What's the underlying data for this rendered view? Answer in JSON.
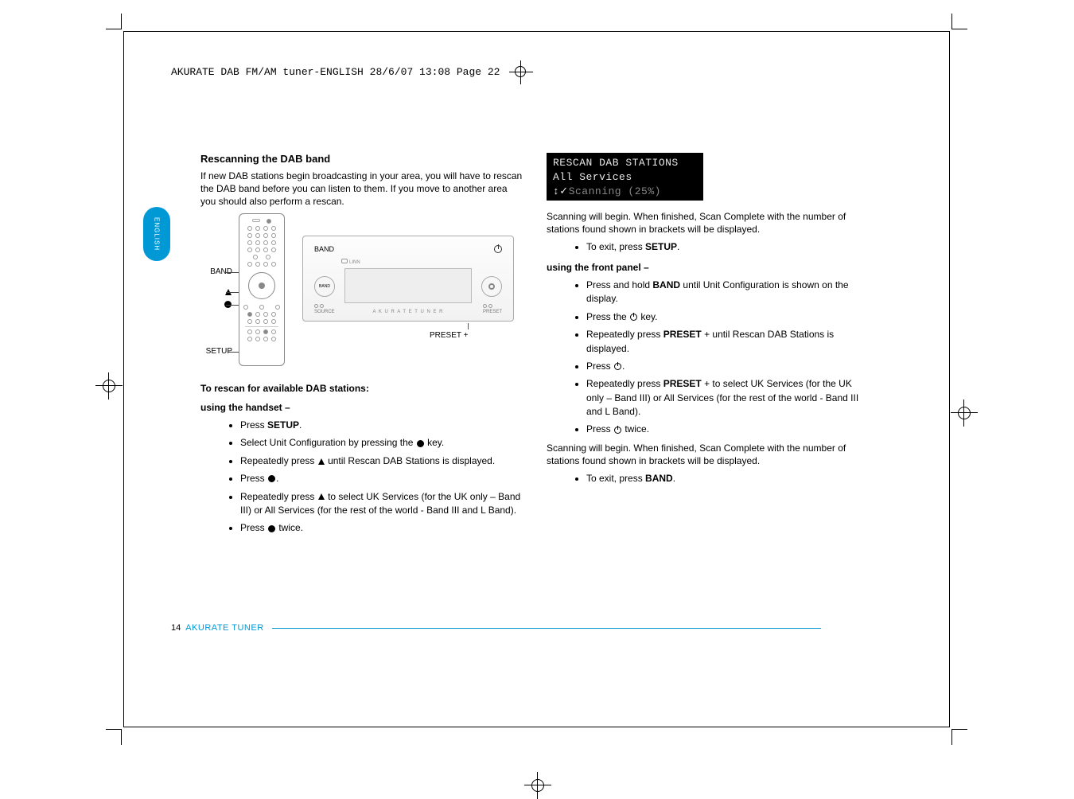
{
  "header": "AKURATE DAB FM/AM tuner-ENGLISH  28/6/07  13:08  Page 22",
  "lang_tab": "ENGLISH",
  "left": {
    "title": "Rescanning the DAB band",
    "intro": "If new DAB stations begin broadcasting in your area, you will have to rescan the DAB band before you can listen to them. If you move to another area you should also perform a rescan.",
    "diagram": {
      "remote_labels": {
        "band": "BAND",
        "up": "",
        "ok": "",
        "setup": "SETUP"
      },
      "device_labels": {
        "band": "BAND",
        "preset": "PRESET +",
        "brand": "A K U R A T E   T U N E R",
        "source": "SOURCE",
        "preset_small": "PRESET",
        "linn": "LINN",
        "band_btn": "BAND"
      }
    },
    "heading2": "To rescan for available DAB stations:",
    "sub1": "using the handset –",
    "steps": {
      "s1a": "Press ",
      "s1b": "SETUP",
      "s1c": ".",
      "s2a": "Select Unit Configuration by pressing the ",
      "s2b": " key.",
      "s3a": "Repeatedly press ",
      "s3b": " until Rescan DAB Stations is displayed.",
      "s4a": "Press ",
      "s4b": ".",
      "s5a": "Repeatedly press ",
      "s5b": " to select UK Services (for the UK only – Band III) or All Services (for the rest of the world - Band III and L Band).",
      "s6a": "Press ",
      "s6b": " twice."
    }
  },
  "right": {
    "lcd": {
      "l1": "RESCAN DAB STATIONS",
      "l2": " All Services",
      "l3a": "↕✓",
      "l3b": "Scanning (25%)"
    },
    "after_scan": "Scanning will begin. When finished, Scan Complete with the number of stations found shown in brackets will be displayed.",
    "exit_setup_a": "To exit, press ",
    "exit_setup_b": "SETUP",
    "exit_setup_c": ".",
    "sub2": "using the front panel –",
    "fp": {
      "s1a": "Press and hold ",
      "s1b": "BAND",
      "s1c": " until Unit Configuration is shown on the display.",
      "s2a": "Press the ",
      "s2b": " key.",
      "s3a": "Repeatedly press ",
      "s3b": "PRESET",
      "s3c": " + until Rescan DAB Stations is displayed.",
      "s4a": "Press ",
      "s4b": ".",
      "s5a": "Repeatedly press ",
      "s5b": "PRESET",
      "s5c": " + to select UK Services (for the UK only – Band III) or All Services (for the rest of the world - Band III and L Band).",
      "s6a": "Press ",
      "s6b": " twice."
    },
    "after_scan2": "Scanning will begin. When finished, Scan Complete with the number of stations found shown in brackets will be displayed.",
    "exit_band_a": "To exit, press ",
    "exit_band_b": "BAND",
    "exit_band_c": "."
  },
  "footer": {
    "page": "14",
    "product": "AKURATE TUNER"
  }
}
